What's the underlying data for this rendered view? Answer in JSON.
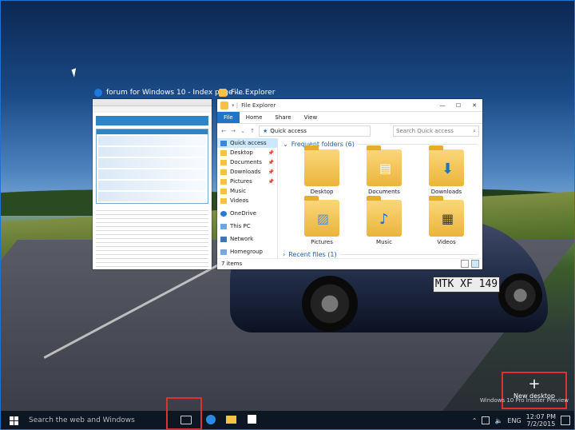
{
  "wallpaper": {
    "license_plate": "MTK XF 149"
  },
  "windows": {
    "browser": {
      "title": "forum for Windows 10 - Index page -..."
    },
    "explorer": {
      "title": "File Explorer",
      "window_title": "File Explorer",
      "ribbon_tabs": [
        "File",
        "Home",
        "Share",
        "View"
      ],
      "address": "Quick access",
      "search_placeholder": "Search Quick access",
      "nav_items": [
        "Quick access",
        "Desktop",
        "Documents",
        "Downloads",
        "Pictures",
        "Music",
        "Videos",
        "OneDrive",
        "This PC",
        "Network",
        "Homegroup"
      ],
      "frequent_header": "Frequent folders (6)",
      "folders": [
        "Desktop",
        "Documents",
        "Downloads",
        "Pictures",
        "Music",
        "Videos"
      ],
      "recent_header": "Recent files (1)",
      "status": "7 items"
    }
  },
  "task_view": {
    "new_desktop_label": "New desktop",
    "watermark_line1": "Windows 10 Pro Insider Preview"
  },
  "taskbar": {
    "search_placeholder": "Search the web and Windows",
    "language": "ENG",
    "time": "12:07 PM",
    "date": "7/2/2015"
  },
  "colors": {
    "accent": "#1f73c9",
    "highlight_box": "#e0322c",
    "taskbar": "#0d1623"
  }
}
